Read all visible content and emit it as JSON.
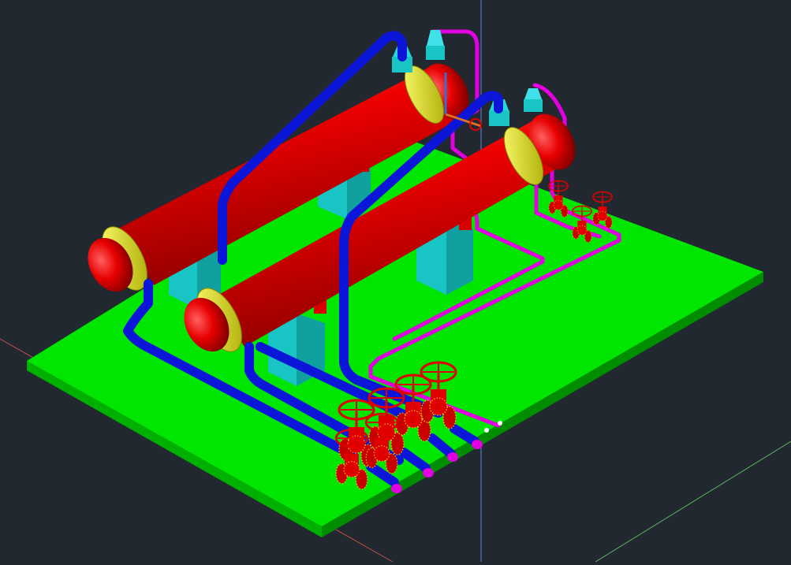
{
  "viewport": {
    "background": "#212830",
    "visual_style": "shaded",
    "projection": "isometric"
  },
  "colors": {
    "platform_top": "#00e600",
    "platform_side": "#00b400",
    "vessel": "#ee0000",
    "vessel_flange": "#e8e800",
    "saddle": "#19c4c4",
    "saddle_cap": "#d80000",
    "pipe_blue": "#0b16d8",
    "pipe_magenta": "#e000e0",
    "valve": "#e00000",
    "axis_x": "#c0504d",
    "axis_y": "#5b6fd6",
    "axis_z": "#6fc36f"
  },
  "model": {
    "platform": "skid-base",
    "vessels": [
      "vessel-rear",
      "vessel-front"
    ],
    "saddles": 4,
    "outlet_valves_blue": 4,
    "valves_magenta_right": 3
  }
}
